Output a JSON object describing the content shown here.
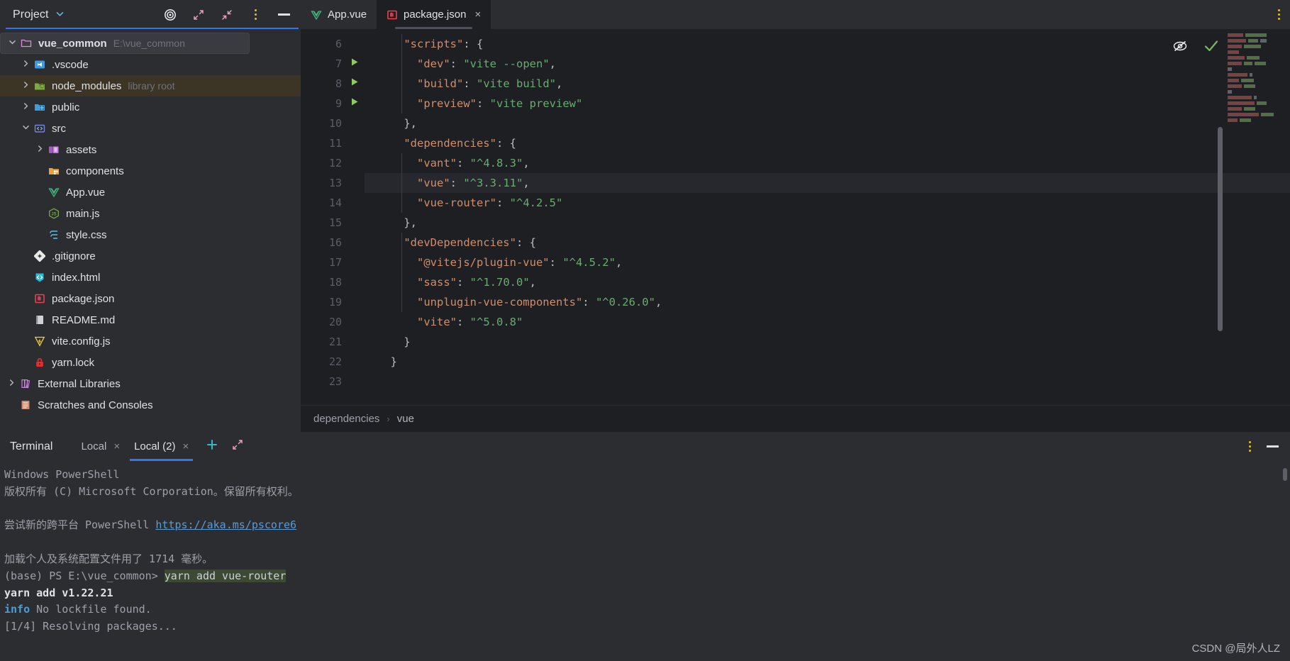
{
  "project_panel": {
    "title": "Project",
    "icons": [
      "locate-target-icon",
      "expand-all-icon",
      "collapse-all-icon",
      "more-options-icon",
      "hide-panel-icon"
    ],
    "tree": [
      {
        "depth": 0,
        "arrow": "down",
        "icon": "folder-module-icon",
        "label": "vue_common",
        "sub": "E:\\vue_common",
        "state": "selected",
        "bold": true
      },
      {
        "depth": 1,
        "arrow": "right",
        "icon": "vscode-folder-icon",
        "label": ".vscode",
        "sub": ""
      },
      {
        "depth": 1,
        "arrow": "right",
        "icon": "node-modules-folder-icon",
        "label": "node_modules",
        "sub": "library root",
        "state": "library"
      },
      {
        "depth": 1,
        "arrow": "right",
        "icon": "public-folder-icon",
        "label": "public",
        "sub": ""
      },
      {
        "depth": 1,
        "arrow": "down",
        "icon": "source-folder-icon",
        "label": "src",
        "sub": ""
      },
      {
        "depth": 2,
        "arrow": "right",
        "icon": "assets-folder-icon",
        "label": "assets",
        "sub": ""
      },
      {
        "depth": 2,
        "arrow": "none",
        "icon": "components-folder-icon",
        "label": "components",
        "sub": ""
      },
      {
        "depth": 2,
        "arrow": "none",
        "icon": "vue-file-icon",
        "label": "App.vue",
        "sub": ""
      },
      {
        "depth": 2,
        "arrow": "none",
        "icon": "javascript-file-icon",
        "label": "main.js",
        "sub": ""
      },
      {
        "depth": 2,
        "arrow": "none",
        "icon": "css-file-icon",
        "label": "style.css",
        "sub": ""
      },
      {
        "depth": 1,
        "arrow": "none",
        "icon": "git-file-icon",
        "label": ".gitignore",
        "sub": ""
      },
      {
        "depth": 1,
        "arrow": "none",
        "icon": "html-file-icon",
        "label": "index.html",
        "sub": ""
      },
      {
        "depth": 1,
        "arrow": "none",
        "icon": "npm-package-file-icon",
        "label": "package.json",
        "sub": ""
      },
      {
        "depth": 1,
        "arrow": "none",
        "icon": "markdown-file-icon",
        "label": "README.md",
        "sub": ""
      },
      {
        "depth": 1,
        "arrow": "none",
        "icon": "vite-config-file-icon",
        "label": "vite.config.js",
        "sub": ""
      },
      {
        "depth": 1,
        "arrow": "none",
        "icon": "lock-file-icon",
        "label": "yarn.lock",
        "sub": ""
      },
      {
        "depth": 0,
        "arrow": "right",
        "icon": "external-libraries-icon",
        "label": "External Libraries",
        "sub": ""
      },
      {
        "depth": 0,
        "arrow": "none",
        "icon": "scratches-icon",
        "label": "Scratches and Consoles",
        "sub": ""
      }
    ]
  },
  "editor": {
    "tabs": [
      {
        "label": "App.vue",
        "icon": "vue-file-icon",
        "active": false,
        "closable": false
      },
      {
        "label": "package.json",
        "icon": "npm-package-file-icon",
        "active": true,
        "closable": true,
        "close_label": "×"
      }
    ],
    "inspection_icons": [
      "inspections-hidden-icon",
      "no-problems-checkmark-icon"
    ],
    "more_options_label": "more-options-icon",
    "lines": [
      {
        "num": "6",
        "run": false,
        "hl": false,
        "tokens": [
          {
            "t": "    ",
            "c": "p"
          },
          {
            "t": "\"scripts\"",
            "c": "key"
          },
          {
            "t": ": {",
            "c": "p"
          }
        ]
      },
      {
        "num": "7",
        "run": true,
        "hl": false,
        "tokens": [
          {
            "t": "      ",
            "c": "p"
          },
          {
            "t": "\"dev\"",
            "c": "key"
          },
          {
            "t": ": ",
            "c": "p"
          },
          {
            "t": "\"vite --open\"",
            "c": "str"
          },
          {
            "t": ",",
            "c": "p"
          }
        ]
      },
      {
        "num": "8",
        "run": true,
        "hl": false,
        "tokens": [
          {
            "t": "      ",
            "c": "p"
          },
          {
            "t": "\"build\"",
            "c": "key"
          },
          {
            "t": ": ",
            "c": "p"
          },
          {
            "t": "\"vite build\"",
            "c": "str"
          },
          {
            "t": ",",
            "c": "p"
          }
        ]
      },
      {
        "num": "9",
        "run": true,
        "hl": false,
        "tokens": [
          {
            "t": "      ",
            "c": "p"
          },
          {
            "t": "\"preview\"",
            "c": "key"
          },
          {
            "t": ": ",
            "c": "p"
          },
          {
            "t": "\"vite preview\"",
            "c": "str"
          }
        ]
      },
      {
        "num": "10",
        "run": false,
        "hl": false,
        "tokens": [
          {
            "t": "    },",
            "c": "p"
          }
        ]
      },
      {
        "num": "11",
        "run": false,
        "hl": false,
        "tokens": [
          {
            "t": "    ",
            "c": "p"
          },
          {
            "t": "\"dependencies\"",
            "c": "key"
          },
          {
            "t": ": {",
            "c": "p"
          }
        ]
      },
      {
        "num": "12",
        "run": false,
        "hl": false,
        "tokens": [
          {
            "t": "      ",
            "c": "p"
          },
          {
            "t": "\"vant\"",
            "c": "key"
          },
          {
            "t": ": ",
            "c": "p"
          },
          {
            "t": "\"^4.8.3\"",
            "c": "str"
          },
          {
            "t": ",",
            "c": "p"
          }
        ]
      },
      {
        "num": "13",
        "run": false,
        "hl": true,
        "tokens": [
          {
            "t": "      ",
            "c": "p"
          },
          {
            "t": "\"vue\"",
            "c": "key"
          },
          {
            "t": ": ",
            "c": "p"
          },
          {
            "t": "\"^3.3.11\"",
            "c": "str"
          },
          {
            "t": ",",
            "c": "p"
          }
        ]
      },
      {
        "num": "14",
        "run": false,
        "hl": false,
        "tokens": [
          {
            "t": "      ",
            "c": "p"
          },
          {
            "t": "\"vue-router\"",
            "c": "key"
          },
          {
            "t": ": ",
            "c": "p"
          },
          {
            "t": "\"^4.2.5\"",
            "c": "str"
          }
        ]
      },
      {
        "num": "15",
        "run": false,
        "hl": false,
        "tokens": [
          {
            "t": "    },",
            "c": "p"
          }
        ]
      },
      {
        "num": "16",
        "run": false,
        "hl": false,
        "tokens": [
          {
            "t": "    ",
            "c": "p"
          },
          {
            "t": "\"devDependencies\"",
            "c": "key"
          },
          {
            "t": ": {",
            "c": "p"
          }
        ]
      },
      {
        "num": "17",
        "run": false,
        "hl": false,
        "tokens": [
          {
            "t": "      ",
            "c": "p"
          },
          {
            "t": "\"@vitejs/plugin-vue\"",
            "c": "key"
          },
          {
            "t": ": ",
            "c": "p"
          },
          {
            "t": "\"^4.5.2\"",
            "c": "str"
          },
          {
            "t": ",",
            "c": "p"
          }
        ]
      },
      {
        "num": "18",
        "run": false,
        "hl": false,
        "tokens": [
          {
            "t": "      ",
            "c": "p"
          },
          {
            "t": "\"sass\"",
            "c": "key"
          },
          {
            "t": ": ",
            "c": "p"
          },
          {
            "t": "\"^1.70.0\"",
            "c": "str"
          },
          {
            "t": ",",
            "c": "p"
          }
        ]
      },
      {
        "num": "19",
        "run": false,
        "hl": false,
        "tokens": [
          {
            "t": "      ",
            "c": "p"
          },
          {
            "t": "\"unplugin-vue-components\"",
            "c": "key"
          },
          {
            "t": ": ",
            "c": "p"
          },
          {
            "t": "\"^0.26.0\"",
            "c": "str"
          },
          {
            "t": ",",
            "c": "p"
          }
        ]
      },
      {
        "num": "20",
        "run": false,
        "hl": false,
        "tokens": [
          {
            "t": "      ",
            "c": "p"
          },
          {
            "t": "\"vite\"",
            "c": "key"
          },
          {
            "t": ": ",
            "c": "p"
          },
          {
            "t": "\"^5.0.8\"",
            "c": "str"
          }
        ]
      },
      {
        "num": "21",
        "run": false,
        "hl": false,
        "tokens": [
          {
            "t": "    }",
            "c": "p"
          }
        ]
      },
      {
        "num": "22",
        "run": false,
        "hl": false,
        "tokens": [
          {
            "t": "  }",
            "c": "p"
          }
        ]
      },
      {
        "num": "23",
        "run": false,
        "hl": false,
        "tokens": [
          {
            "t": "",
            "c": "p"
          }
        ]
      }
    ],
    "breadcrumb": [
      "dependencies",
      "vue"
    ],
    "breadcrumb_separator": "›"
  },
  "terminal": {
    "title": "Terminal",
    "tabs": [
      {
        "label": "Local",
        "active": false,
        "close_label": "×"
      },
      {
        "label": "Local (2)",
        "active": true,
        "close_label": "×"
      }
    ],
    "add_label": "+",
    "actions": [
      "add-terminal-icon",
      "maximize-terminal-icon"
    ],
    "right_actions": [
      "more-options-icon",
      "minimize-panel-icon"
    ],
    "lines": [
      [
        {
          "t": "Windows PowerShell",
          "c": "t-dim"
        }
      ],
      [
        {
          "t": "版权所有 (C) Microsoft Corporation。保留所有权利。",
          "c": "t-dim"
        }
      ],
      [
        {
          "t": "",
          "c": "t-dim"
        }
      ],
      [
        {
          "t": "尝试新的跨平台 PowerShell ",
          "c": "t-dim"
        },
        {
          "t": "https://aka.ms/pscore6",
          "c": "t-link"
        }
      ],
      [
        {
          "t": "",
          "c": "t-dim"
        }
      ],
      [
        {
          "t": "加载个人及系统配置文件用了 1714 毫秒。",
          "c": "t-dim"
        }
      ],
      [
        {
          "t": "(base) PS E:\\vue_common> ",
          "c": "t-dim"
        },
        {
          "t": "yarn add vue-router",
          "c": "t-hl"
        }
      ],
      [
        {
          "t": "yarn add v1.22.21",
          "c": "t-bold"
        }
      ],
      [
        {
          "t": "info",
          "c": "t-info"
        },
        {
          "t": " No lockfile found.",
          "c": "t-dim"
        }
      ],
      [
        {
          "t": "[1/4] Resolving packages...",
          "c": "t-dim"
        }
      ]
    ]
  },
  "watermark": "CSDN @局外人LZ",
  "colors": {
    "background": "#2b2d30",
    "editor_background": "#1e1f22",
    "accent_blue": "#3574f0",
    "string_green": "#6aab73",
    "key_orange": "#cf8e6d",
    "selection_row": "#3c3425"
  }
}
